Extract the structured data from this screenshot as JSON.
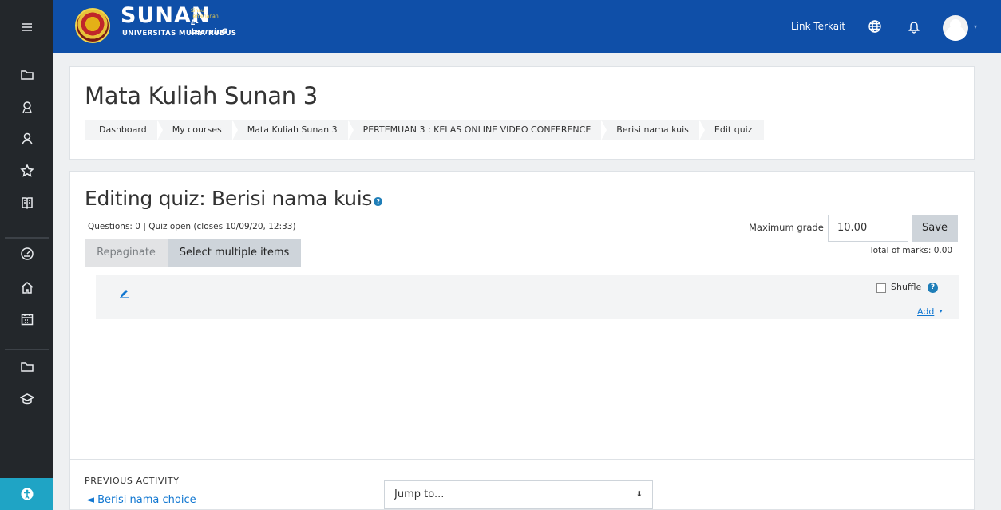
{
  "topbar": {
    "logo_word": "SUNAN",
    "logo_tag_top": "Sinau Temenanan",
    "logo_tag_main": "E-LearninG",
    "logo_uni": "UNIVERSITAS MURIA KUDUS",
    "link_terkait": "Link Terkait",
    "accent": "#0f4fa8"
  },
  "course": {
    "title": "Mata Kuliah Sunan 3",
    "breadcrumbs": [
      "Dashboard",
      "My courses",
      "Mata Kuliah Sunan 3",
      "PERTEMUAN 3 : KELAS ONLINE VIDEO CONFERENCE",
      "Berisi nama kuis",
      "Edit quiz"
    ]
  },
  "quiz": {
    "heading": "Editing quiz: Berisi nama kuis",
    "info": "Questions: 0 | Quiz open (closes 10/09/20, 12:33)",
    "repaginate": "Repaginate",
    "select_multiple": "Select multiple items",
    "max_grade_label": "Maximum grade",
    "max_grade_value": "10.00",
    "save": "Save",
    "total_marks": "Total of marks: 0.00",
    "shuffle": "Shuffle",
    "add": "Add"
  },
  "footer": {
    "previous_label": "PREVIOUS ACTIVITY",
    "previous_link": "◄ Berisi nama choice",
    "jump_to": "Jump to..."
  },
  "colors": {
    "sidebar": "#23272b",
    "accessibility": "#1fa4c5",
    "link": "#1177d1",
    "help": "#1f7eb8"
  },
  "icons": [
    "menu-icon",
    "folder-icon",
    "user-award-icon",
    "users-icon",
    "star-icon",
    "book-icon",
    "dashboard-gauge-icon",
    "home-icon",
    "calendar-icon",
    "folder-icon",
    "graduation-cap-icon",
    "accessibility-icon",
    "globe-icon",
    "bell-icon"
  ]
}
